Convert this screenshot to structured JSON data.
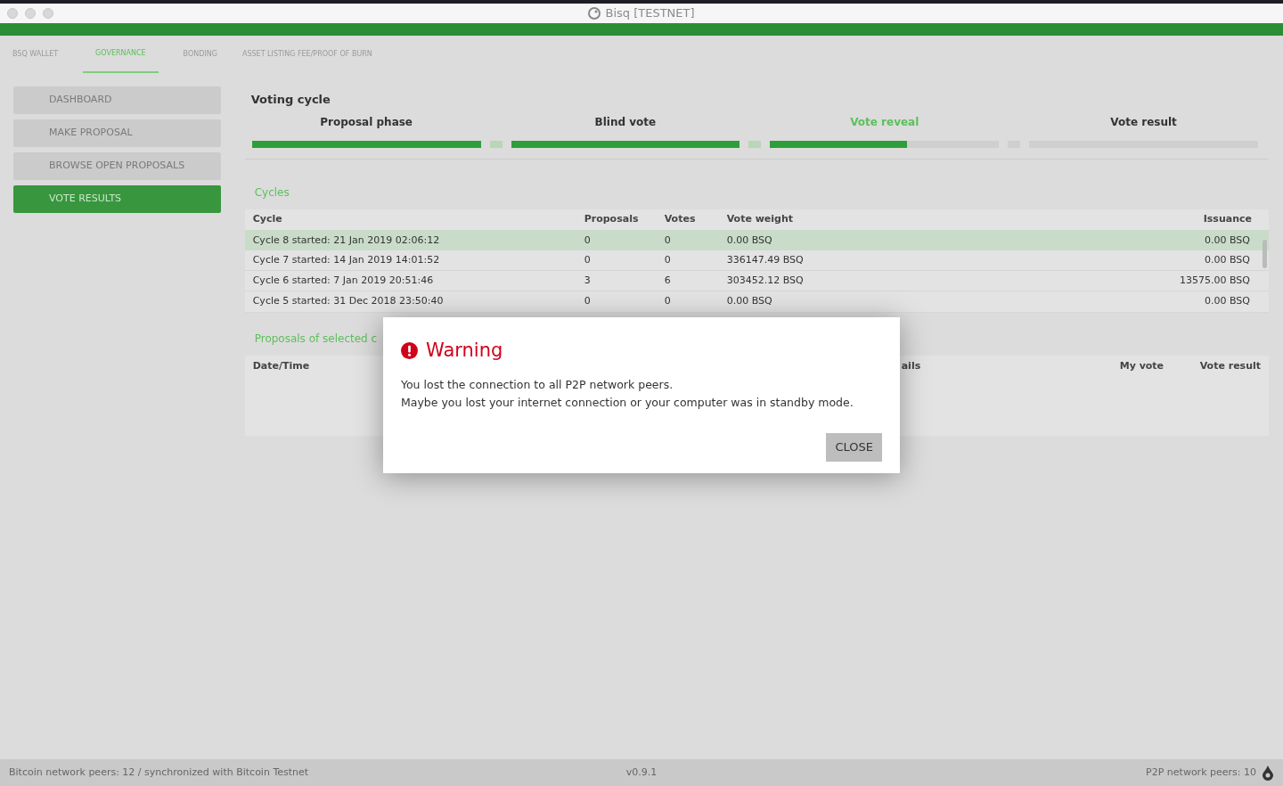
{
  "window": {
    "title": "Bisq [TESTNET]"
  },
  "tabs": [
    {
      "label": "BSQ WALLET",
      "selected": false
    },
    {
      "label": "GOVERNANCE",
      "selected": true
    },
    {
      "label": "BONDING",
      "selected": false
    },
    {
      "label": "ASSET LISTING FEE/PROOF OF BURN",
      "selected": false
    }
  ],
  "sidebar": {
    "items": [
      {
        "label": "DASHBOARD",
        "selected": false
      },
      {
        "label": "MAKE PROPOSAL",
        "selected": false
      },
      {
        "label": "BROWSE OPEN PROPOSALS",
        "selected": false
      },
      {
        "label": "VOTE RESULTS",
        "selected": true
      }
    ]
  },
  "voting_cycle": {
    "title": "Voting cycle",
    "phases": [
      {
        "kind": "phase",
        "label": "Proposal phase",
        "level": 1,
        "selected": false
      },
      {
        "kind": "break",
        "level": 1
      },
      {
        "kind": "phase",
        "label": "Blind vote",
        "level": 1,
        "selected": false
      },
      {
        "kind": "break",
        "level": 1
      },
      {
        "kind": "phase",
        "label": "Vote reveal",
        "level": 0.6,
        "selected": true
      },
      {
        "kind": "break",
        "level": 0
      },
      {
        "kind": "phase",
        "label": "Vote result",
        "level": 0,
        "selected": false
      }
    ]
  },
  "cycles": {
    "title": "Cycles",
    "columns": [
      "Cycle",
      "Proposals",
      "Votes",
      "Vote weight",
      "Issuance"
    ],
    "rows": [
      {
        "cells": [
          "Cycle 8 started: 21 Jan 2019 02:06:12",
          "0",
          "0",
          "0.00 BSQ",
          "0.00 BSQ"
        ],
        "selected": true
      },
      {
        "cells": [
          "Cycle 7 started: 14 Jan 2019 14:01:52",
          "0",
          "0",
          "336147.49 BSQ",
          "0.00 BSQ"
        ],
        "selected": false
      },
      {
        "cells": [
          "Cycle 6 started: 7 Jan 2019 20:51:46",
          "3",
          "6",
          "303452.12 BSQ",
          "13575.00 BSQ"
        ],
        "selected": false
      },
      {
        "cells": [
          "Cycle 5 started: 31 Dec 2018 23:50:40",
          "0",
          "0",
          "0.00 BSQ",
          "0.00 BSQ"
        ],
        "selected": false
      }
    ]
  },
  "proposals": {
    "title": "Proposals of selected c",
    "columns": [
      "Date/Time",
      "ails",
      "My vote",
      "Vote result"
    ]
  },
  "dialog": {
    "title": "Warning",
    "lines": [
      "You lost the connection to all P2P network peers.",
      "Maybe you lost your internet connection or your computer was in standby mode."
    ],
    "button": "CLOSE"
  },
  "status_bar": {
    "left": "Bitcoin network peers: 12 / synchronized with Bitcoin Testnet",
    "center": "v0.9.1",
    "right": "P2P network peers: 10"
  }
}
